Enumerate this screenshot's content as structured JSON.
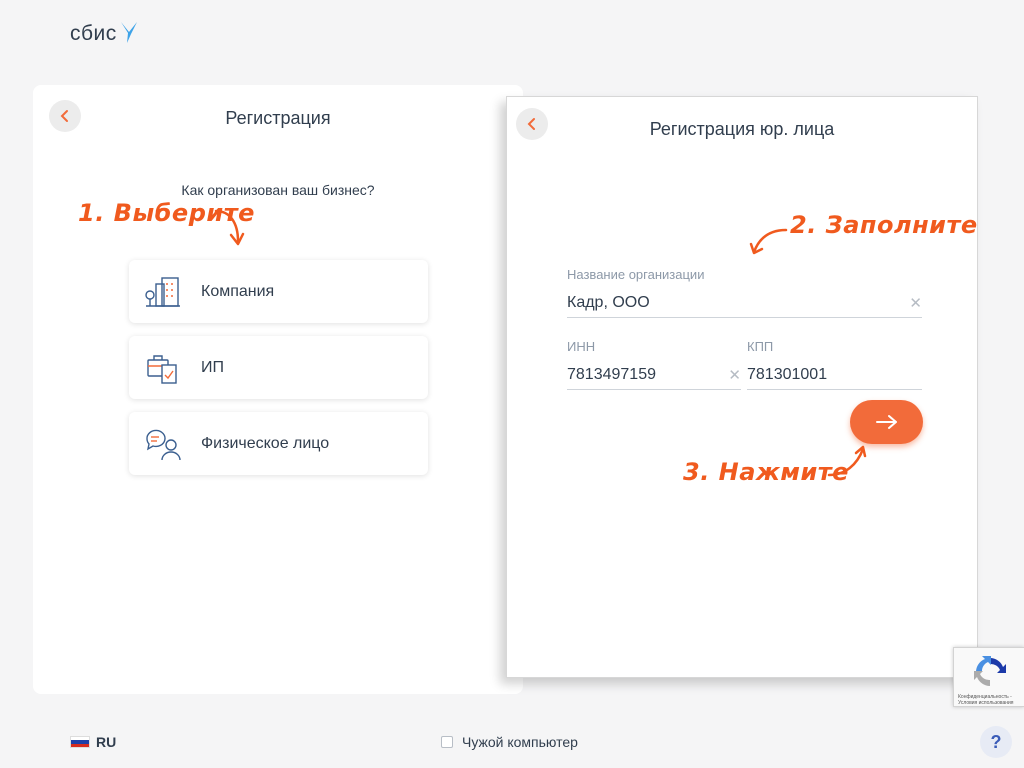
{
  "logo": {
    "text": "сбис"
  },
  "left_panel": {
    "title": "Регистрация",
    "question": "Как организован ваш бизнес?",
    "options": [
      {
        "label": "Компания",
        "icon": "building-icon"
      },
      {
        "label": "ИП",
        "icon": "briefcase-document-icon"
      },
      {
        "label": "Физическое лицо",
        "icon": "person-chat-icon"
      }
    ]
  },
  "right_panel": {
    "title": "Регистрация юр. лица",
    "fields": {
      "org_name": {
        "label": "Название организации",
        "value": "Кадр, ООО"
      },
      "inn": {
        "label": "ИНН",
        "value": "7813497159"
      },
      "kpp": {
        "label": "КПП",
        "value": "781301001"
      }
    }
  },
  "annotations": {
    "step1": "1. Выберите",
    "step2": "2. Заполните",
    "step3": "3. Нажмите"
  },
  "recaptcha": {
    "text": "Конфиденциальность - Условия использования"
  },
  "footer": {
    "language": "RU",
    "foreign_computer": "Чужой компьютер",
    "help": "?"
  },
  "colors": {
    "accent": "#f26b3a",
    "annotation": "#f05a1e",
    "text": "#313e4e",
    "logo_bird": "#3ea3e8",
    "help_text": "#3b5cb8"
  }
}
